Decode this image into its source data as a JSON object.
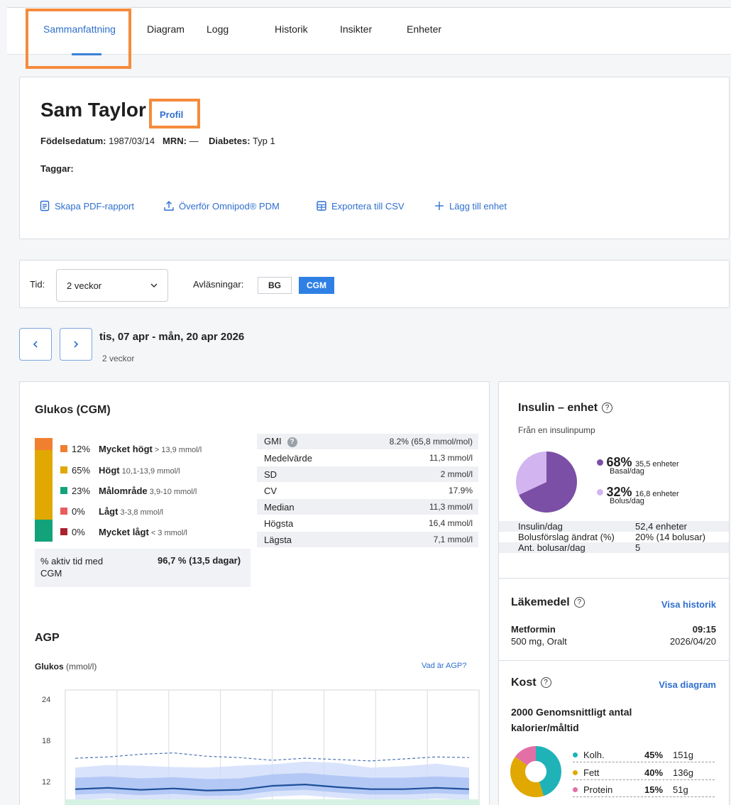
{
  "tabs": [
    {
      "label": "Sammanfattning",
      "active": true
    },
    {
      "label": "Diagram"
    },
    {
      "label": "Logg"
    },
    {
      "label": "Historik"
    },
    {
      "label": "Insikter"
    },
    {
      "label": "Enheter"
    }
  ],
  "patient": {
    "name": "Sam Taylor",
    "profile_link": "Profil",
    "dob_label": "Födelsedatum:",
    "dob": "1987/03/14",
    "mrn_label": "MRN:",
    "mrn": "—",
    "diabetes_label": "Diabetes:",
    "diabetes": "Typ 1",
    "tags_label": "Taggar:"
  },
  "actions": {
    "pdf": "Skapa PDF-rapport",
    "transfer": "Överför Omnipod® PDM",
    "csv": "Exportera till CSV",
    "add_device": "Lägg till enhet"
  },
  "filters": {
    "time_label": "Tid:",
    "time_value": "2 veckor",
    "readings_label": "Avläsningar:",
    "bg": "BG",
    "cgm": "CGM",
    "selected": "CGM"
  },
  "range": {
    "main": "tis, 07 apr - mån, 20 apr 2026",
    "sub": "2 veckor"
  },
  "glucose": {
    "title": "Glukos (CGM)",
    "tir": [
      {
        "pct": "12%",
        "label": "Mycket högt",
        "range": "> 13,9 mmol/l",
        "color": "#f07f2f"
      },
      {
        "pct": "65%",
        "label": "Högt",
        "range": "10,1-13,9 mmol/l",
        "color": "#e0a800"
      },
      {
        "pct": "23%",
        "label": "Målområde",
        "range": "3,9-10 mmol/l",
        "color": "#13a37a"
      },
      {
        "pct": "0%",
        "label": "Lågt",
        "range": "3-3,8 mmol/l",
        "color": "#e85c5c"
      },
      {
        "pct": "0%",
        "label": "Mycket lågt",
        "range": "< 3 mmol/l",
        "color": "#a8232f"
      }
    ],
    "tir_values": [
      12,
      65,
      23,
      0,
      0
    ],
    "active_label": "% aktiv tid med CGM",
    "active_value": "96,7 % (13,5 dagar)",
    "stats": [
      {
        "k": "GMI",
        "v": "8.2% (65,8 mmol/mol)"
      },
      {
        "k": "Medelvärde",
        "v": "11,3 mmol/l"
      },
      {
        "k": "SD",
        "v": "2 mmol/l"
      },
      {
        "k": "CV",
        "v": "17.9%"
      },
      {
        "k": "Median",
        "v": "11,3 mmol/l"
      },
      {
        "k": "Högsta",
        "v": "16,4 mmol/l"
      },
      {
        "k": "Lägsta",
        "v": "7,1 mmol/l"
      }
    ]
  },
  "agp": {
    "title": "AGP",
    "y_title": "Glukos",
    "y_unit": "(mmol/l)",
    "link": "Vad är AGP?",
    "y_ticks": [
      "24",
      "18",
      "12"
    ]
  },
  "insulin": {
    "title": "Insulin – enhet",
    "subtitle": "Från en insulinpump",
    "basal_pct": "68%",
    "basal_units": "35,5 enheter",
    "basal_label": "Basal/dag",
    "bolus_pct": "32%",
    "bolus_units": "16,8 enheter",
    "bolus_label": "Bolus/dag",
    "basal_color": "#7b4fa6",
    "bolus_color": "#d2b4f0",
    "rows": [
      {
        "k": "Insulin/dag",
        "v": "52,4 enheter"
      },
      {
        "k": "Bolusförslag ändrat (%)",
        "v": "20% (14 bolusar)"
      },
      {
        "k": "Ant. bolusar/dag",
        "v": "5"
      }
    ]
  },
  "medication": {
    "title": "Läkemedel",
    "link": "Visa historik",
    "name": "Metformin",
    "dose": "500 mg, Oralt",
    "time": "09:15",
    "date": "2026/04/20"
  },
  "diet": {
    "title": "Kost",
    "link": "Visa diagram",
    "summary": "2000 Genomsnittligt antal kalorier/måltid",
    "macros": [
      {
        "name": "Kolh.",
        "pct": "45%",
        "grams": "151g",
        "color": "#1fb3b8"
      },
      {
        "name": "Fett",
        "pct": "40%",
        "grams": "136g",
        "color": "#e0a800"
      },
      {
        "name": "Protein",
        "pct": "15%",
        "grams": "51g",
        "color": "#e36fa6"
      }
    ]
  },
  "chart_data": [
    {
      "type": "pie",
      "categories": [
        "Basal/dag",
        "Bolus/dag"
      ],
      "values": [
        68,
        32
      ]
    },
    {
      "type": "pie",
      "categories": [
        "Kolh.",
        "Fett",
        "Protein"
      ],
      "values": [
        45,
        40,
        15
      ]
    },
    {
      "type": "line",
      "title": "AGP",
      "ylabel": "Glukos (mmol/l)",
      "y_ticks": [
        24,
        18,
        12
      ],
      "ylim": [
        10,
        25
      ],
      "series": [
        {
          "values": [
            11.3,
            11.5,
            11.2,
            11.4,
            11.1,
            11.2,
            11.8,
            12.0,
            11.6,
            11.3,
            11.3,
            11.5,
            11.3
          ]
        },
        {
          "values": [
            15.9,
            16.1,
            16.5,
            16.7,
            16.2,
            16.0,
            15.6,
            15.9,
            15.7,
            15.5,
            15.8,
            16.1,
            16.0
          ]
        }
      ]
    }
  ]
}
